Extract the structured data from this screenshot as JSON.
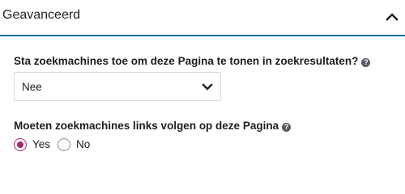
{
  "panel": {
    "title": "Geavanceerd",
    "expanded": true,
    "toggle_icon": "chevron-up-icon"
  },
  "fields": {
    "search_visibility": {
      "question": "Sta zoekmachines toe om deze Pagina te tonen in zoekresultaten?",
      "help_icon": "question-circle-icon",
      "select_value": "Nee",
      "select_icon": "chevron-down-icon"
    },
    "follow_links": {
      "question": "Moeten zoekmachines links volgen op deze Pagina",
      "help_icon": "question-circle-icon",
      "options": [
        {
          "label": "Yes",
          "checked": true
        },
        {
          "label": "No",
          "checked": false
        }
      ]
    }
  },
  "colors": {
    "accent": "#a4286a",
    "focus_line": "#1e6fa8",
    "text": "#1e1e1e",
    "help_icon_bg": "#555d66"
  }
}
